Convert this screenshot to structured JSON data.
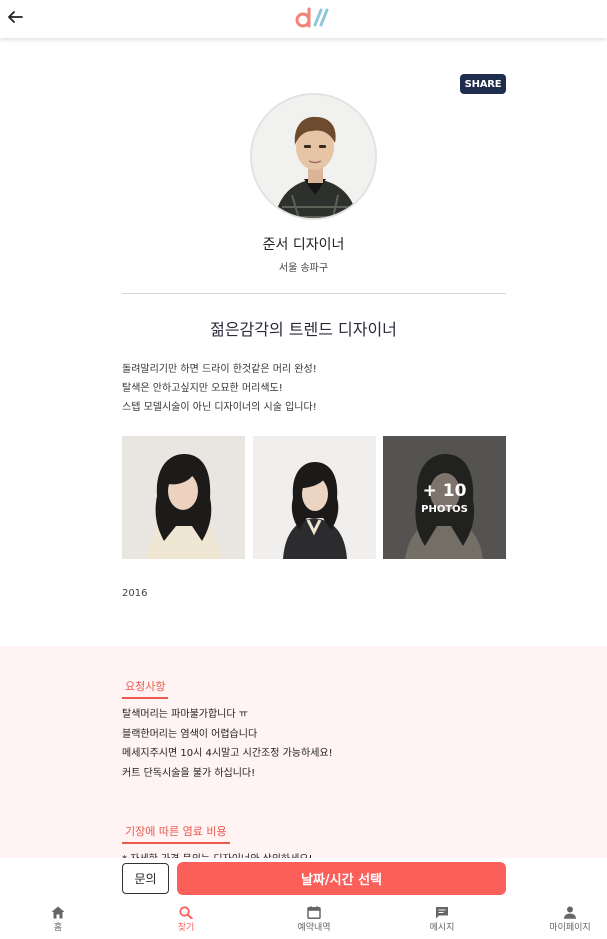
{
  "header": {
    "back_icon": "arrow-left-icon",
    "logo_icon": "dm-logo-icon"
  },
  "share_label": "SHARE",
  "designer": {
    "name": "준서 디자이너",
    "location": "서울 송파구",
    "headline": "젊은감각의 트렌드 디자이너",
    "intro": [
      "돌려말리기만 하면 드라이 한것같은 머리 완성!",
      "탈색은 안하고싶지만 오묘한 머리색도!",
      "스텝 모델시술이 아닌 디자이너의 시술 입니다!"
    ],
    "photos_more": "+ 10",
    "photos_label": "PHOTOS",
    "year": "2016"
  },
  "requests": {
    "title": "요청사항",
    "items": [
      "탈색머리는 파마불가합니다 ㅠ",
      "블랙한머리는 염색이 어렵습니다",
      "메세지주시면 10시 4시말고 시간조정 가능하세요!",
      "커트 단독시술을 불가 하십니다!"
    ]
  },
  "cost": {
    "title": "기장에 따른 염료 비용",
    "note": "* 자세한 가격 문의는 디자이너와 상의하세요!"
  },
  "actions": {
    "ask": "문의",
    "book": "날짜/시간 선택"
  },
  "nav": [
    {
      "label": "홈",
      "icon": "home-icon"
    },
    {
      "label": "찾기",
      "icon": "search-icon",
      "active": true
    },
    {
      "label": "예약내역",
      "icon": "calendar-icon"
    },
    {
      "label": "메시지",
      "icon": "message-icon"
    },
    {
      "label": "마이페이지",
      "icon": "person-icon"
    }
  ],
  "colors": {
    "accent": "#fb5f5a",
    "share_bg": "#1f2d4d",
    "section_bg": "#fff3f3"
  }
}
